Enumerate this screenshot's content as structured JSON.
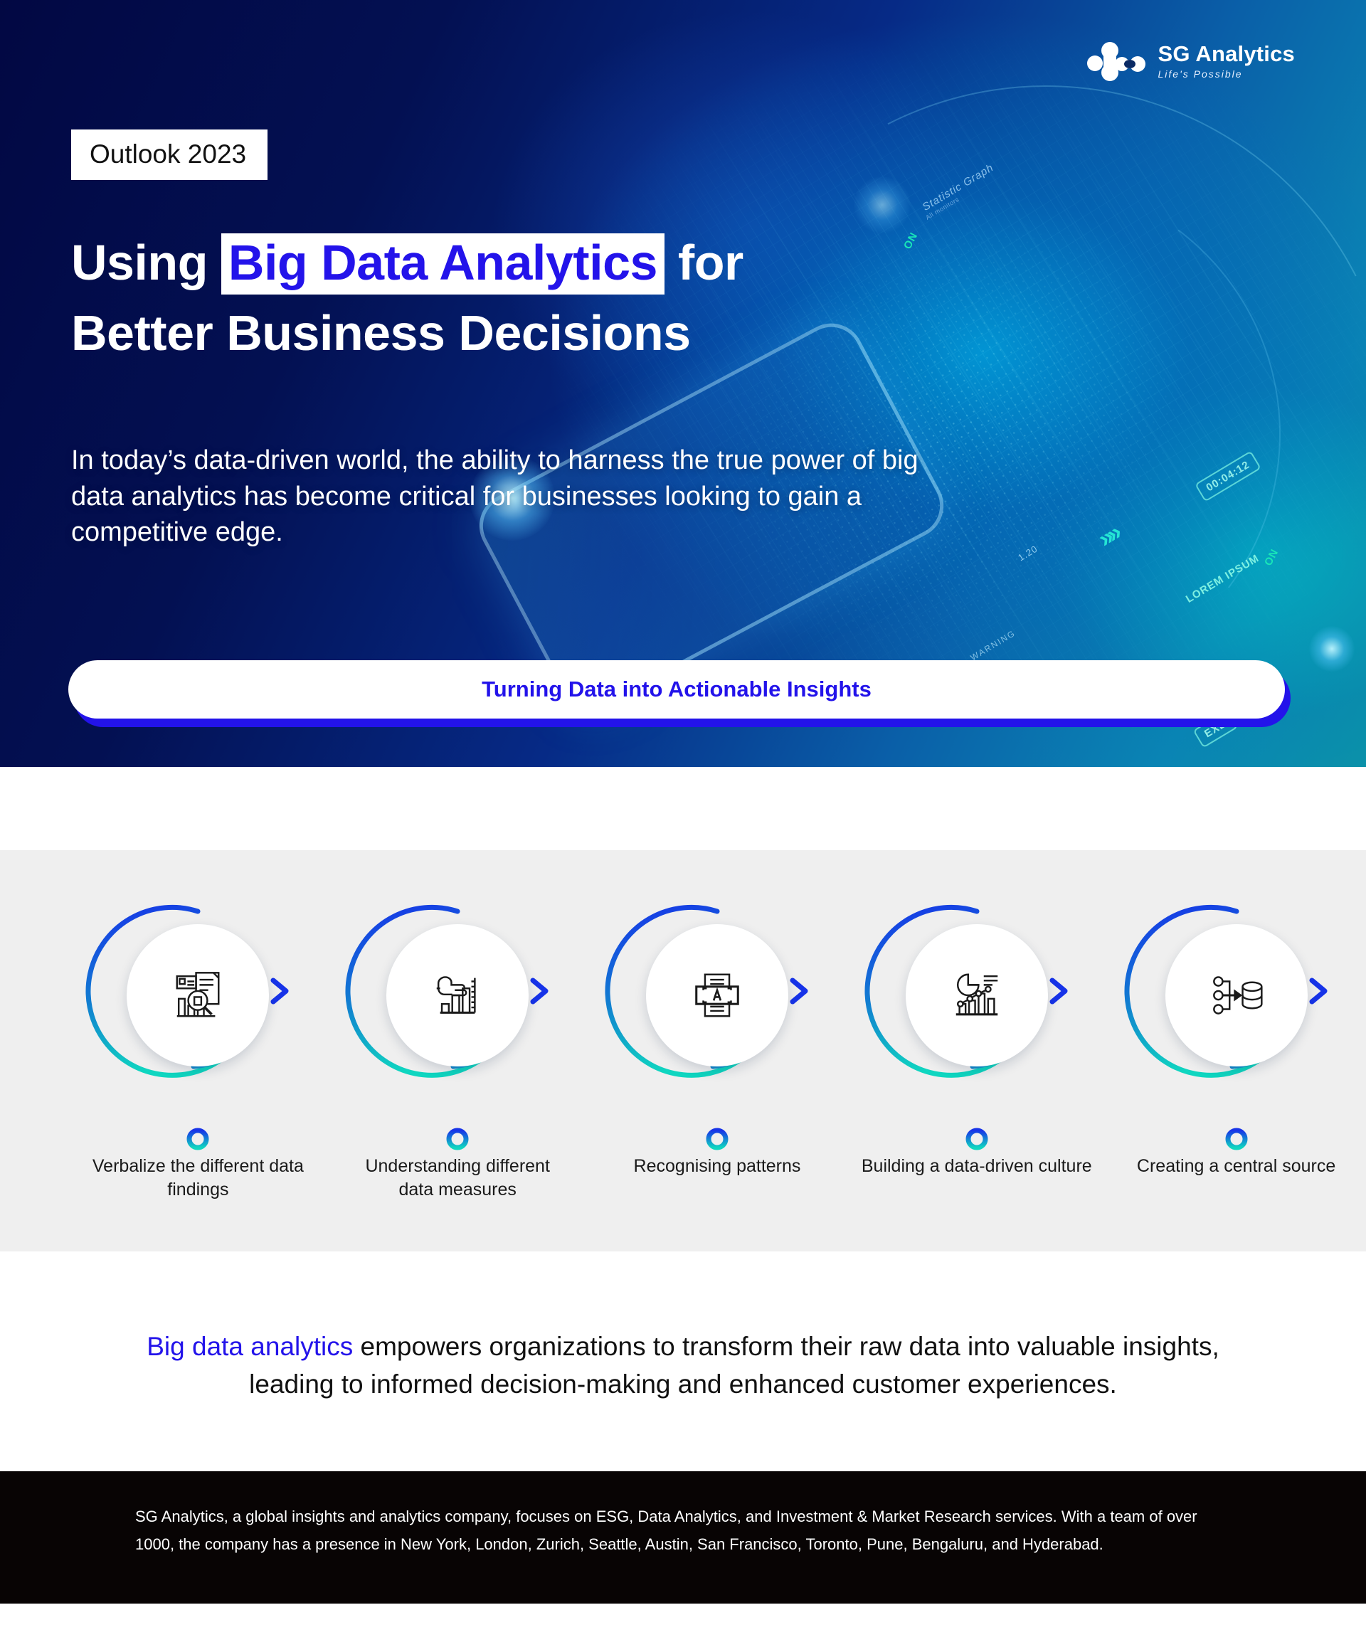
{
  "brand": {
    "logo_name": "SG Analytics",
    "logo_tagline": "Life's Possible",
    "logo_icon": "sg-analytics-node-logo",
    "accent_blue": "#2313ea",
    "hero_dark": "#030b4d",
    "ring_blue": "#1340e8",
    "ring_teal": "#0fd6c0",
    "band_gray": "#efefef",
    "footer_black": "#080404"
  },
  "hero": {
    "badge": "Outlook 2023",
    "title_part1": "Using ",
    "title_highlight": "Big Data Analytics",
    "title_part2": " for",
    "title_line2": "Better Business Decisions",
    "subtitle": "In today’s data-driven world, the ability to harness the true power of big data analytics has become critical for businesses looking to gain a competitive edge.",
    "cta_label": "Turning Data into Actionable Insights",
    "decor": {
      "statistic_graph": "Statistic Graph",
      "statistic_sub": "All monitors",
      "on_1": "ON",
      "on_2": "ON",
      "timer": "00:04:12",
      "lorem": "LOREM IPSUM",
      "exe": "EXE",
      "num_120": "1.20",
      "warning": "WARNING",
      "chevrons": "»»"
    }
  },
  "steps": {
    "items": [
      {
        "icon": "document-report-search-icon",
        "label": "Verbalize the different data findings"
      },
      {
        "icon": "hand-pointing-bar-chart-icon",
        "label": "Understanding different data measures"
      },
      {
        "icon": "pattern-scan-letter-a-icon",
        "label": "Recognising patterns"
      },
      {
        "icon": "analytics-dashboard-icon",
        "label": "Building a data-driven culture"
      },
      {
        "icon": "data-sources-to-database-icon",
        "label": "Creating a central source"
      }
    ]
  },
  "conclusion": {
    "accent": "Big data analytics",
    "rest": " empowers organizations to transform their raw data into valuable insights, leading to informed decision-making and enhanced customer experiences."
  },
  "footer": {
    "text": "SG Analytics, a global insights and analytics company, focuses on ESG, Data Analytics, and Investment & Market Research services. With a team of over 1000, the company has a presence in New York, London, Zurich, Seattle, Austin, San Francisco, Toronto, Pune, Bengaluru, and Hyderabad."
  }
}
